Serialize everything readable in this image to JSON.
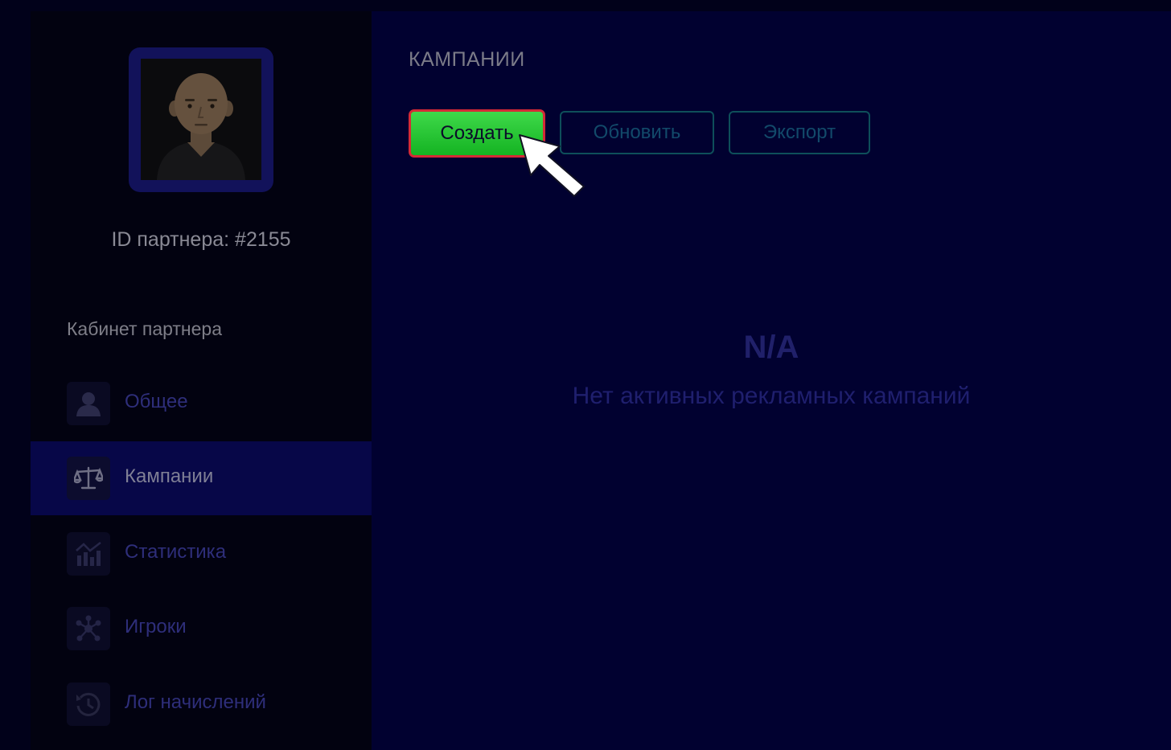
{
  "sidebar": {
    "partner_id": "ID партнера: #2155",
    "section_title": "Кабинет партнера",
    "items": [
      {
        "label": "Общее",
        "icon": "user-icon",
        "active": false
      },
      {
        "label": "Кампании",
        "icon": "scales-icon",
        "active": true
      },
      {
        "label": "Статистика",
        "icon": "chart-icon",
        "active": false
      },
      {
        "label": "Игроки",
        "icon": "network-icon",
        "active": false
      },
      {
        "label": "Лог начислений",
        "icon": "history-icon",
        "active": false
      }
    ]
  },
  "main": {
    "title": "КАМПАНИИ",
    "buttons": {
      "create": "Создать",
      "refresh": "Обновить",
      "export": "Экспорт"
    },
    "empty_state": {
      "title": "N/A",
      "message": "Нет активных рекламных кампаний"
    }
  },
  "colors": {
    "background": "#010130",
    "sidebar": "#020210",
    "active_item": "#070748",
    "create_button": "#2ecc40",
    "create_border": "#d42a36"
  }
}
